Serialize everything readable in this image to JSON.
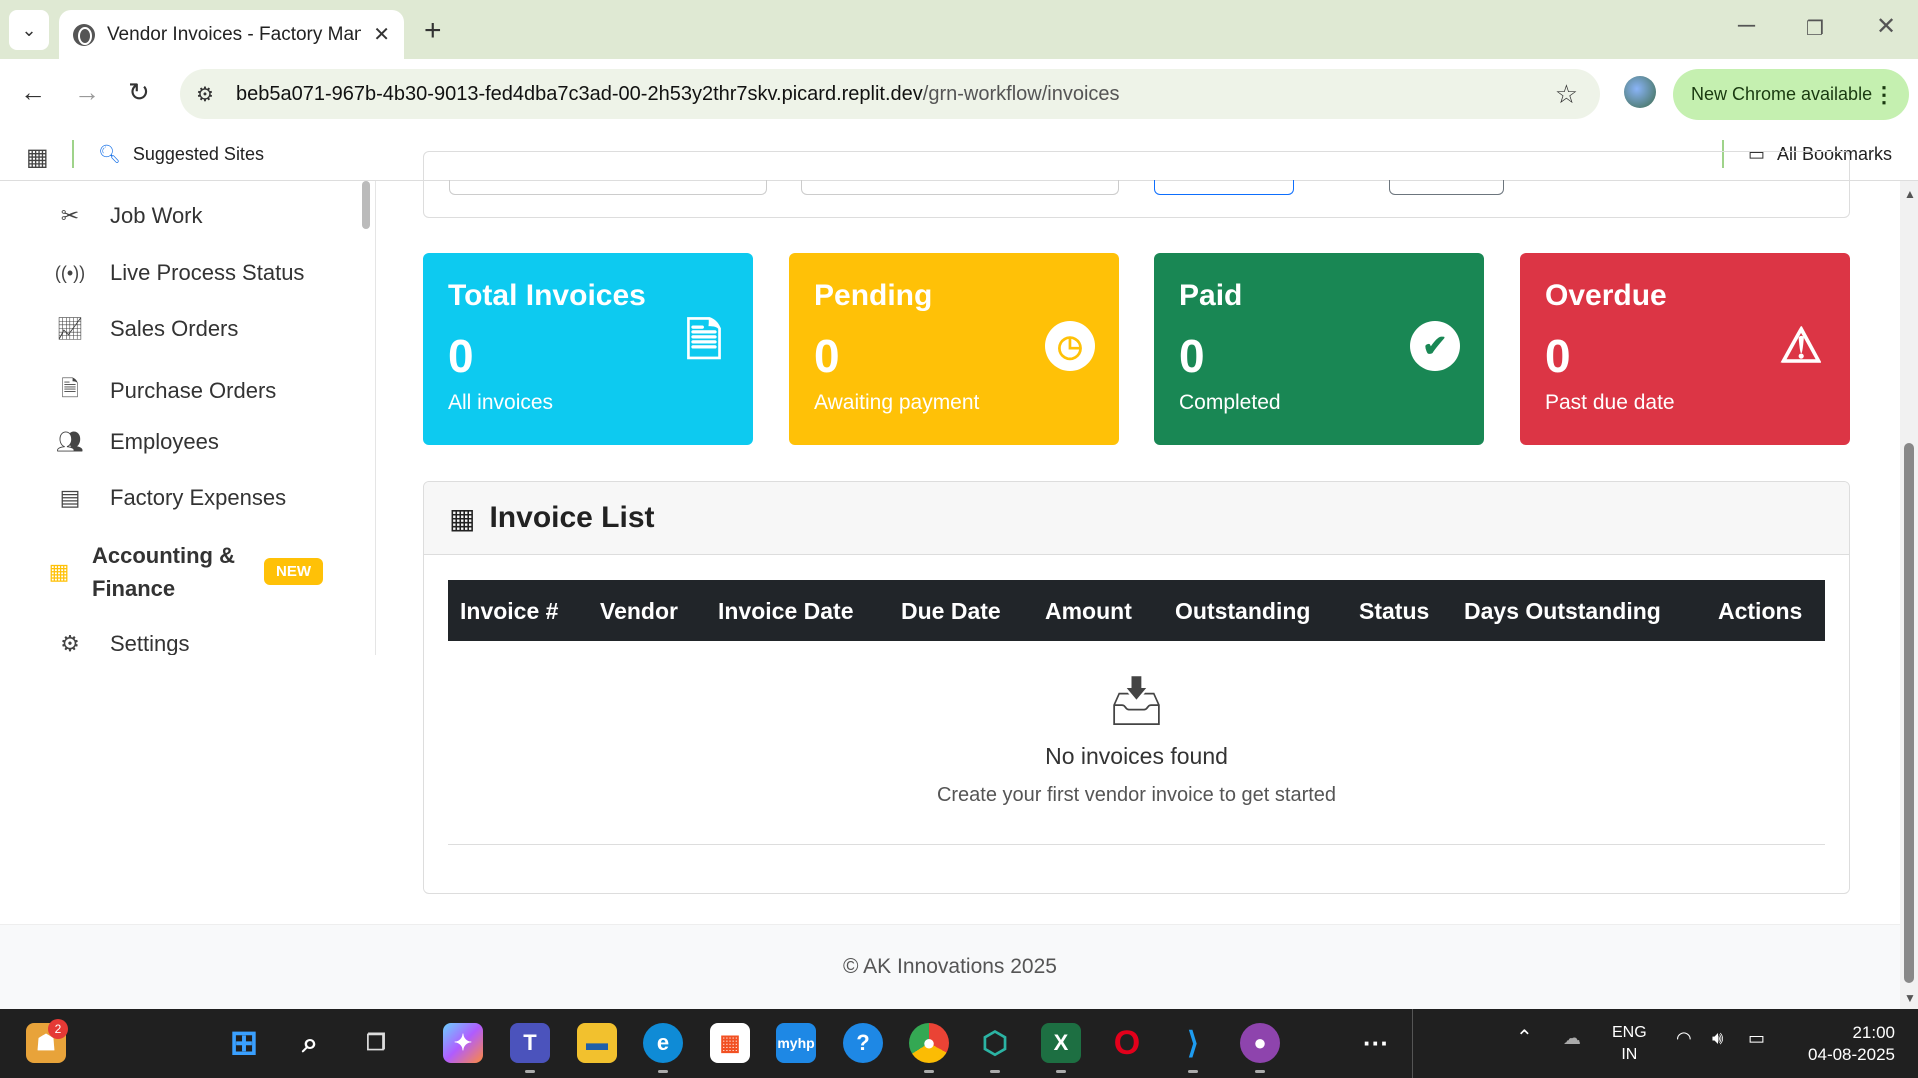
{
  "browser": {
    "tab_title": "Vendor Invoices - Factory Management",
    "url_host": "beb5a071-967b-4b30-9013-fed4dba7c3ad-00-2h53y2thr7skv.picard.replit.dev",
    "url_path": "/grn-workflow/invoices",
    "update_label": "New Chrome available",
    "bookmarks": {
      "suggested": "Suggested Sites",
      "all": "All Bookmarks"
    }
  },
  "sidebar": {
    "items": [
      {
        "label": "Job Work",
        "icon": "tools-icon"
      },
      {
        "label": "Live Process Status",
        "icon": "broadcast-icon"
      },
      {
        "label": "Sales Orders",
        "icon": "chart-line-icon"
      },
      {
        "label": "Purchase Orders",
        "icon": "file-invoice-icon"
      },
      {
        "label": "Employees",
        "icon": "users-icon"
      },
      {
        "label": "Factory Expenses",
        "icon": "receipt-icon"
      },
      {
        "label": "Accounting & Finance",
        "icon": "calculator-icon",
        "badge": "NEW"
      },
      {
        "label": "Settings",
        "icon": "gear-icon"
      }
    ]
  },
  "stats": [
    {
      "title": "Total Invoices",
      "value": "0",
      "sub": "All invoices",
      "color": "#0dcaf0",
      "icon": "file-invoice-icon"
    },
    {
      "title": "Pending",
      "value": "0",
      "sub": "Awaiting payment",
      "color": "#ffc107",
      "icon": "clock-icon"
    },
    {
      "title": "Paid",
      "value": "0",
      "sub": "Completed",
      "color": "#198754",
      "icon": "check-circle-icon"
    },
    {
      "title": "Overdue",
      "value": "0",
      "sub": "Past due date",
      "color": "#dc3545",
      "icon": "warning-icon"
    }
  ],
  "invoice_list": {
    "title": "Invoice List",
    "columns": [
      "Invoice #",
      "Vendor",
      "Invoice Date",
      "Due Date",
      "Amount",
      "Outstanding",
      "Status",
      "Days Outstanding",
      "Actions"
    ],
    "empty_title": "No invoices found",
    "empty_sub": "Create your first vendor invoice to get started"
  },
  "footer": {
    "text": "© AK Innovations 2025"
  },
  "taskbar": {
    "notif_count": "2",
    "lang": "ENG",
    "region": "IN",
    "time": "21:00",
    "date": "04-08-2025"
  }
}
